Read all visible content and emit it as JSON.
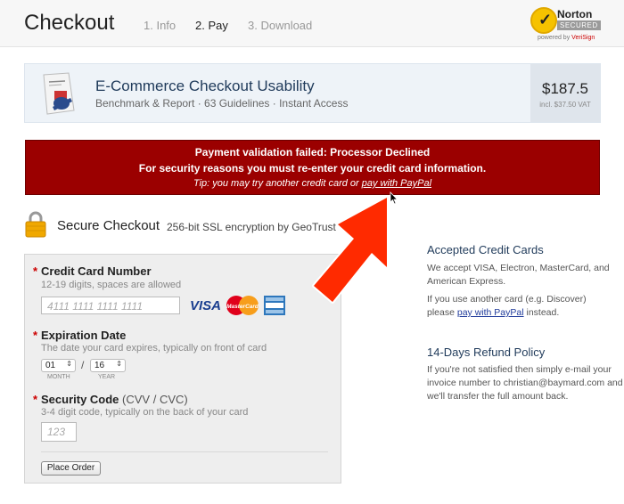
{
  "header": {
    "title": "Checkout",
    "steps": [
      "1. Info",
      "2. Pay",
      "3. Download"
    ],
    "badge": {
      "brand": "Norton",
      "secured": "SECURED",
      "powered_prefix": "powered by",
      "powered_by": "VeriSign"
    }
  },
  "product": {
    "name": "E-Commerce Checkout Usability",
    "description": "Benchmark & Report · 63 Guidelines · Instant Access",
    "price": "$187.5",
    "vat": "incl. $37.50 VAT"
  },
  "error": {
    "line1": "Payment validation failed: Processor Declined",
    "line2": "For security reasons you must re-enter your credit card information.",
    "tip_prefix": "Tip: you may try another credit card or ",
    "tip_link": "pay with PayPal"
  },
  "secure": {
    "title": "Secure Checkout",
    "subtitle": "256-bit SSL encryption by GeoTrust"
  },
  "form": {
    "card_number": {
      "label": "Credit Card Number",
      "help": "12-19 digits, spaces are allowed",
      "placeholder": "4111 1111 1111 1111"
    },
    "cards": [
      "VISA",
      "MasterCard",
      "American Express"
    ],
    "expiration": {
      "label": "Expiration Date",
      "help": "The date your card expires, typically on front of card",
      "month": "01",
      "year": "16",
      "month_label": "MONTH",
      "year_label": "YEAR",
      "separator": "/"
    },
    "security_code": {
      "label": "Security Code",
      "label_extra": "(CVV / CVC)",
      "help": "3-4 digit code, typically on the back of your card",
      "placeholder": "123"
    },
    "submit": "Place Order"
  },
  "sidebar": {
    "cards_title": "Accepted Credit Cards",
    "cards_text": "We accept VISA, Electron, MasterCard, and American Express.",
    "other_prefix": "If you use another card (e.g. Discover) please ",
    "other_link": "pay with PayPal",
    "other_suffix": " instead.",
    "refund_title": "14-Days Refund Policy",
    "refund_text": "If you're not satisfied then simply e-mail your invoice number to christian@baymard.com and we'll transfer the full amount back."
  },
  "colors": {
    "error_bg": "#9b0000",
    "arrow": "#ff2a00",
    "link": "#1f3a9a"
  }
}
